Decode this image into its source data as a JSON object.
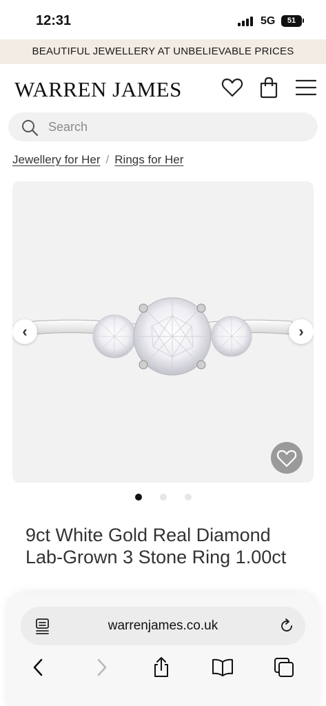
{
  "status_bar": {
    "time": "12:31",
    "network": "5G",
    "battery": "51"
  },
  "promo": {
    "text": "BEAUTIFUL JEWELLERY AT UNBELIEVABLE PRICES"
  },
  "header": {
    "logo": "WARREN JAMES",
    "icons": [
      "heart-icon",
      "bag-icon",
      "menu-icon"
    ]
  },
  "search": {
    "placeholder": "Search",
    "value": ""
  },
  "breadcrumb": {
    "items": [
      "Jewellery for Her",
      "Rings for Her"
    ],
    "separator": "/"
  },
  "gallery": {
    "prev_icon": "‹",
    "next_icon": "›",
    "image_count": 3,
    "active_index": 0,
    "background": "#f2f2f2"
  },
  "product": {
    "title": "9ct White Gold Real Diamond Lab-Grown 3 Stone Ring 1.00ct"
  },
  "browser": {
    "url": "warrenjames.co.uk",
    "icons": [
      "reader-icon",
      "reload-icon",
      "back-icon",
      "forward-icon",
      "share-icon",
      "bookmarks-icon",
      "tabs-icon"
    ]
  },
  "colors": {
    "promo_bg": "#f3ece4",
    "text": "#333333",
    "wish_button": "#9a9a9a"
  }
}
